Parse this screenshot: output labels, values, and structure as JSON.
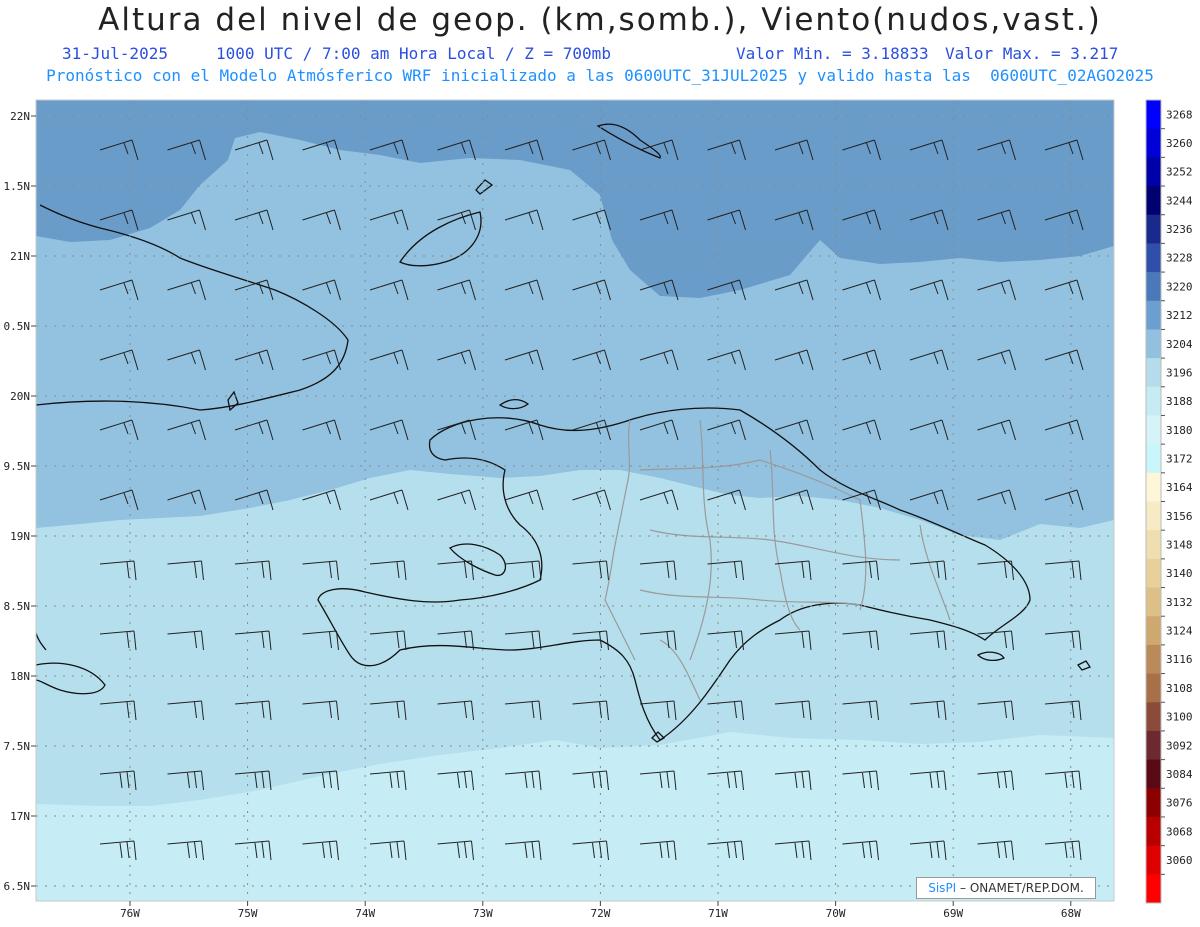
{
  "header": {
    "title": "Altura del nivel de geop. (km,somb.), Viento(nudos,vast.)",
    "date": "31-Jul-2025",
    "time": "1000 UTC / 7:00 am Hora Local / Z = 700mb",
    "vmin": "Valor Min. = 3.18833",
    "vmax": "Valor Max. = 3.217",
    "forecast": "Pronóstico con el Modelo Atmósferico WRF inicializado a las 0600UTC_31JUL2025 y valido hasta las  0600UTC_02AGO2025"
  },
  "axes": {
    "lat_labels": [
      "22N",
      "1.5N",
      "21N",
      "0.5N",
      "20N",
      "9.5N",
      "19N",
      "8.5N",
      "18N",
      "7.5N",
      "17N",
      "6.5N"
    ],
    "lon_labels": [
      "76W",
      "75W",
      "74W",
      "73W",
      "72W",
      "71W",
      "70W",
      "69W",
      "68W"
    ]
  },
  "colorbar": {
    "labels": [
      "3268",
      "3260",
      "3252",
      "3244",
      "3236",
      "3228",
      "3220",
      "3212",
      "3204",
      "3196",
      "3188",
      "3180",
      "3172",
      "3164",
      "3156",
      "3148",
      "3140",
      "3132",
      "3124",
      "3116",
      "3108",
      "3100",
      "3092",
      "3084",
      "3076",
      "3068",
      "3060"
    ],
    "colors": [
      "#0000ff",
      "#0000d8",
      "#0000a8",
      "#000070",
      "#1a2a8c",
      "#2f4fa8",
      "#4a78b8",
      "#6a9fcf",
      "#92c0e0",
      "#b4dcea",
      "#c6ebf3",
      "#d6f4f8",
      "#c8f6fb",
      "#fdf6d8",
      "#f6ebc4",
      "#efdfb0",
      "#e8d09a",
      "#ddc088",
      "#cfa870",
      "#bb8a5a",
      "#a87048",
      "#8c4a3a",
      "#6e2830",
      "#5a0a14",
      "#8c0000",
      "#b80000",
      "#e00000",
      "#ff0000"
    ]
  },
  "fields": {
    "colors": {
      "dark_band": "#6a9cca",
      "mid_band": "#92c2e0",
      "light_band": "#b6dfee",
      "lightest_band": "#c6edf5"
    }
  },
  "credit": {
    "brand": "SisPI",
    "org": "– ONAMET/REP.DOM."
  }
}
